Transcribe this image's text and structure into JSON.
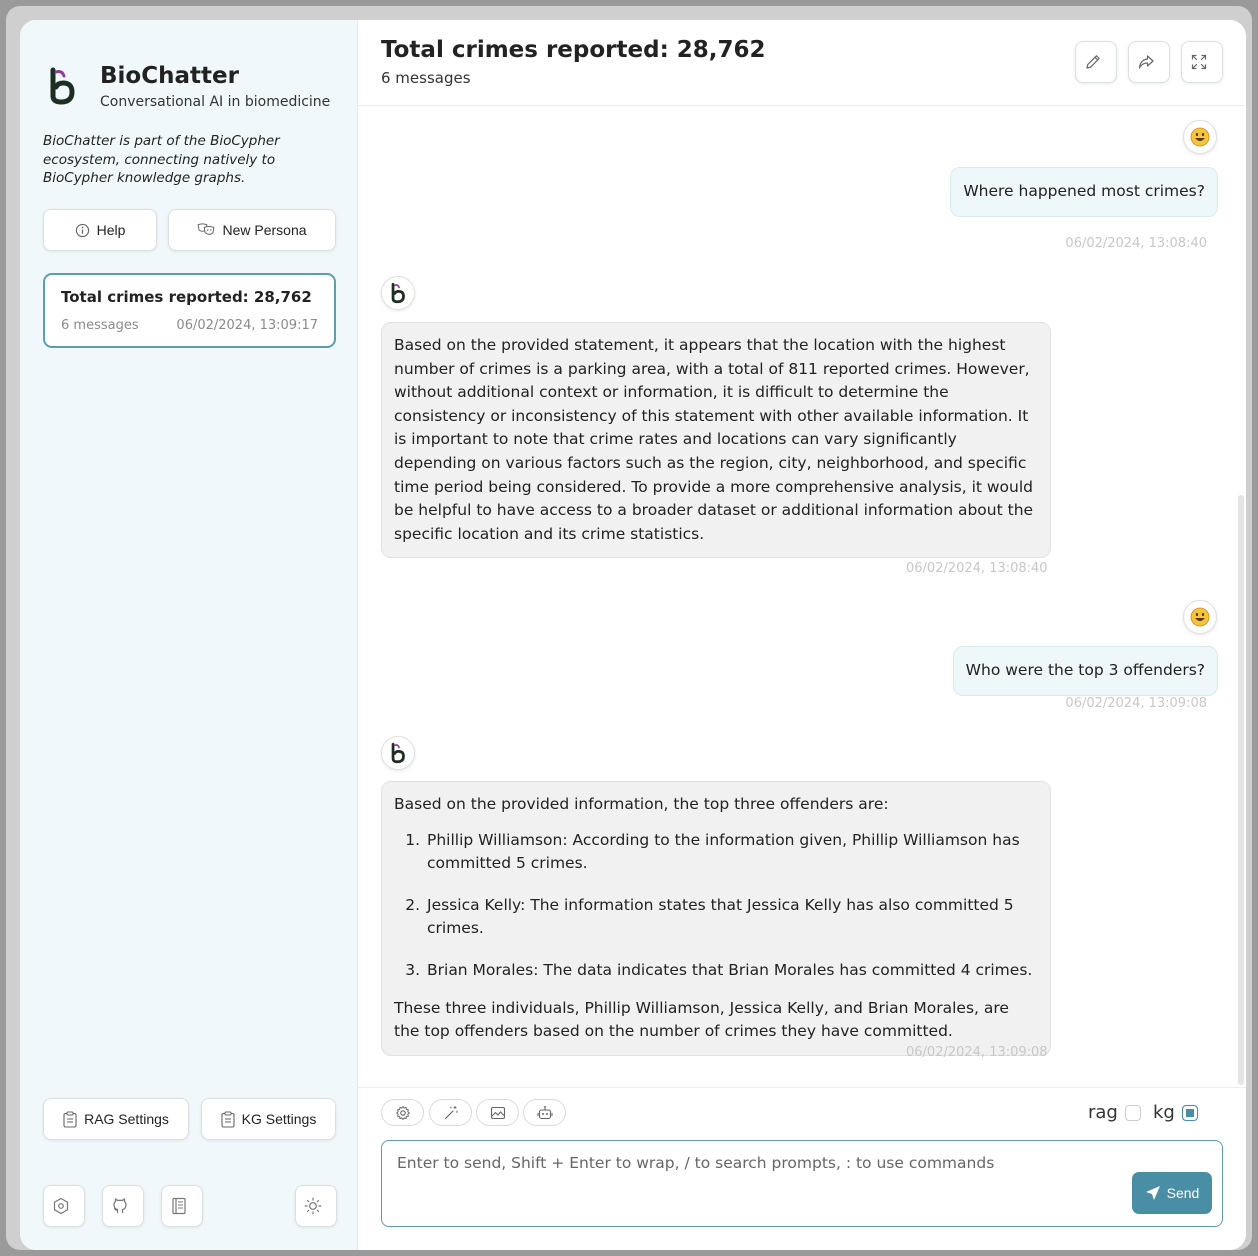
{
  "brand": {
    "title": "BioChatter",
    "subtitle": "Conversational AI in biomedicine",
    "description": "BioChatter is part of the BioCypher ecosystem, connecting natively to BioCypher knowledge graphs."
  },
  "sidebar": {
    "help_label": "Help",
    "new_persona_label": "New Persona",
    "conversation": {
      "title": "Total crimes reported: 28,762",
      "messages": "6 messages",
      "timestamp": "06/02/2024, 13:09:17"
    },
    "rag_settings_label": "RAG Settings",
    "kg_settings_label": "KG Settings"
  },
  "header": {
    "title": "Total crimes reported: 28,762",
    "subtitle": "6 messages"
  },
  "messages": [
    {
      "role": "user",
      "text": "Where happened most crimes?",
      "timestamp": "06/02/2024, 13:08:40"
    },
    {
      "role": "assistant",
      "text": "Based on the provided statement, it appears that the location with the highest number of crimes is a parking area, with a total of 811 reported crimes. However, without additional context or information, it is difficult to determine the consistency or inconsistency of this statement with other available information. It is important to note that crime rates and locations can vary significantly depending on various factors such as the region, city, neighborhood, and specific time period being considered. To provide a more comprehensive analysis, it would be helpful to have access to a broader dataset or additional information about the specific location and its crime statistics.",
      "timestamp": "06/02/2024, 13:08:40"
    },
    {
      "role": "user",
      "text": "Who were the top 3 offenders?",
      "timestamp": "06/02/2024, 13:09:08"
    },
    {
      "role": "assistant",
      "intro": "Based on the provided information, the top three offenders are:",
      "items": [
        "Phillip Williamson: According to the information given, Phillip Williamson has committed 5 crimes.",
        "Jessica Kelly: The information states that Jessica Kelly has also committed 5 crimes.",
        "Brian Morales: The data indicates that Brian Morales has committed 4 crimes."
      ],
      "outro": "These three individuals, Phillip Williamson, Jessica Kelly, and Brian Morales, are the top offenders based on the number of crimes they have committed.",
      "timestamp": "06/02/2024, 13:09:08"
    }
  ],
  "input": {
    "placeholder": "Enter to send, Shift + Enter to wrap, / to search prompts, : to use commands",
    "value": "",
    "send_label": "Send",
    "rag_label": "rag",
    "rag_checked": false,
    "kg_label": "kg",
    "kg_checked": true
  },
  "colors": {
    "accent": "#4a8ea5",
    "sidebar_bg": "#f1f8fb",
    "user_bubble": "#eef7fa",
    "bot_bubble": "#f1f1f1"
  },
  "icons": {
    "user_avatar": "smiley-face-icon",
    "bot_avatar": "biochatter-logo-icon"
  }
}
